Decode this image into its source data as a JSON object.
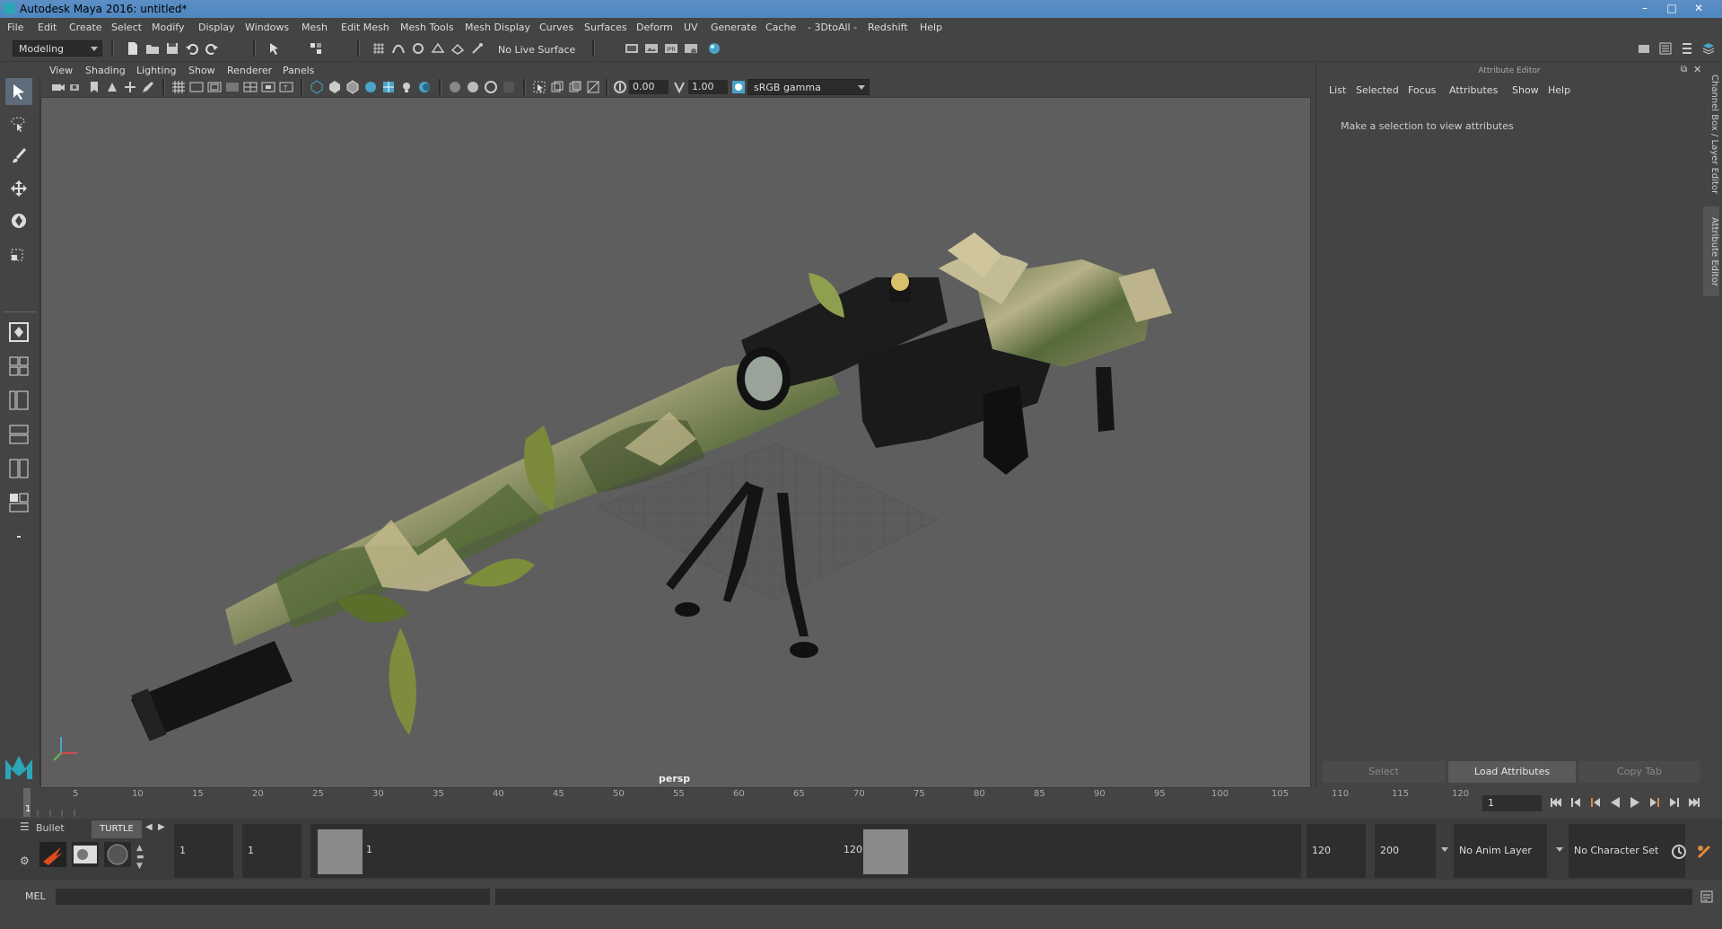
{
  "window": {
    "title": "Autodesk Maya 2016: untitled*"
  },
  "menus": [
    "File",
    "Edit",
    "Create",
    "Select",
    "Modify",
    "Display",
    "Windows",
    "Mesh",
    "Edit Mesh",
    "Mesh Tools",
    "Mesh Display",
    "Curves",
    "Surfaces",
    "Deform",
    "UV",
    "Generate",
    "Cache",
    "- 3DtoAll -",
    "Redshift",
    "Help"
  ],
  "statusline": {
    "menuset": "Modeling",
    "live_surface": "No Live Surface"
  },
  "panel_menus": [
    "View",
    "Shading",
    "Lighting",
    "Show",
    "Renderer",
    "Panels"
  ],
  "panel_toolbar": {
    "exposure": "0.00",
    "gamma": "1.00",
    "color_space": "sRGB gamma"
  },
  "viewport": {
    "camera_label": "persp"
  },
  "attribute_editor": {
    "title": "Attribute Editor",
    "menus": [
      "List",
      "Selected",
      "Focus",
      "Attributes",
      "Show",
      "Help"
    ],
    "message": "Make a selection to view attributes",
    "buttons": {
      "select": "Select",
      "load": "Load Attributes",
      "copy_tab": "Copy Tab"
    }
  },
  "side_tabs": {
    "channel_box": "Channel Box / Layer Editor",
    "attribute_editor": "Attribute Editor"
  },
  "timeslider": {
    "ticks": [
      "5",
      "10",
      "15",
      "20",
      "25",
      "30",
      "35",
      "40",
      "45",
      "50",
      "55",
      "60",
      "65",
      "70",
      "75",
      "80",
      "85",
      "90",
      "95",
      "100",
      "105",
      "110",
      "115",
      "120"
    ],
    "current_frame_marker": "1",
    "current_frame_field": "1"
  },
  "shelf_tabs": {
    "bullet": "Bullet",
    "turtle": "TURTLE"
  },
  "range": {
    "start_field": "1",
    "playback_start": "1",
    "range_start_label": "1",
    "range_end_label": "120",
    "playback_end": "120",
    "end_field": "200",
    "anim_layer": "No Anim Layer",
    "character_set": "No Character Set"
  },
  "cmdline": {
    "label": "MEL"
  },
  "colors": {
    "accent_blue": "#5285a6",
    "viewport_bg": "#5e5e5e",
    "panel_bg": "#444444"
  }
}
